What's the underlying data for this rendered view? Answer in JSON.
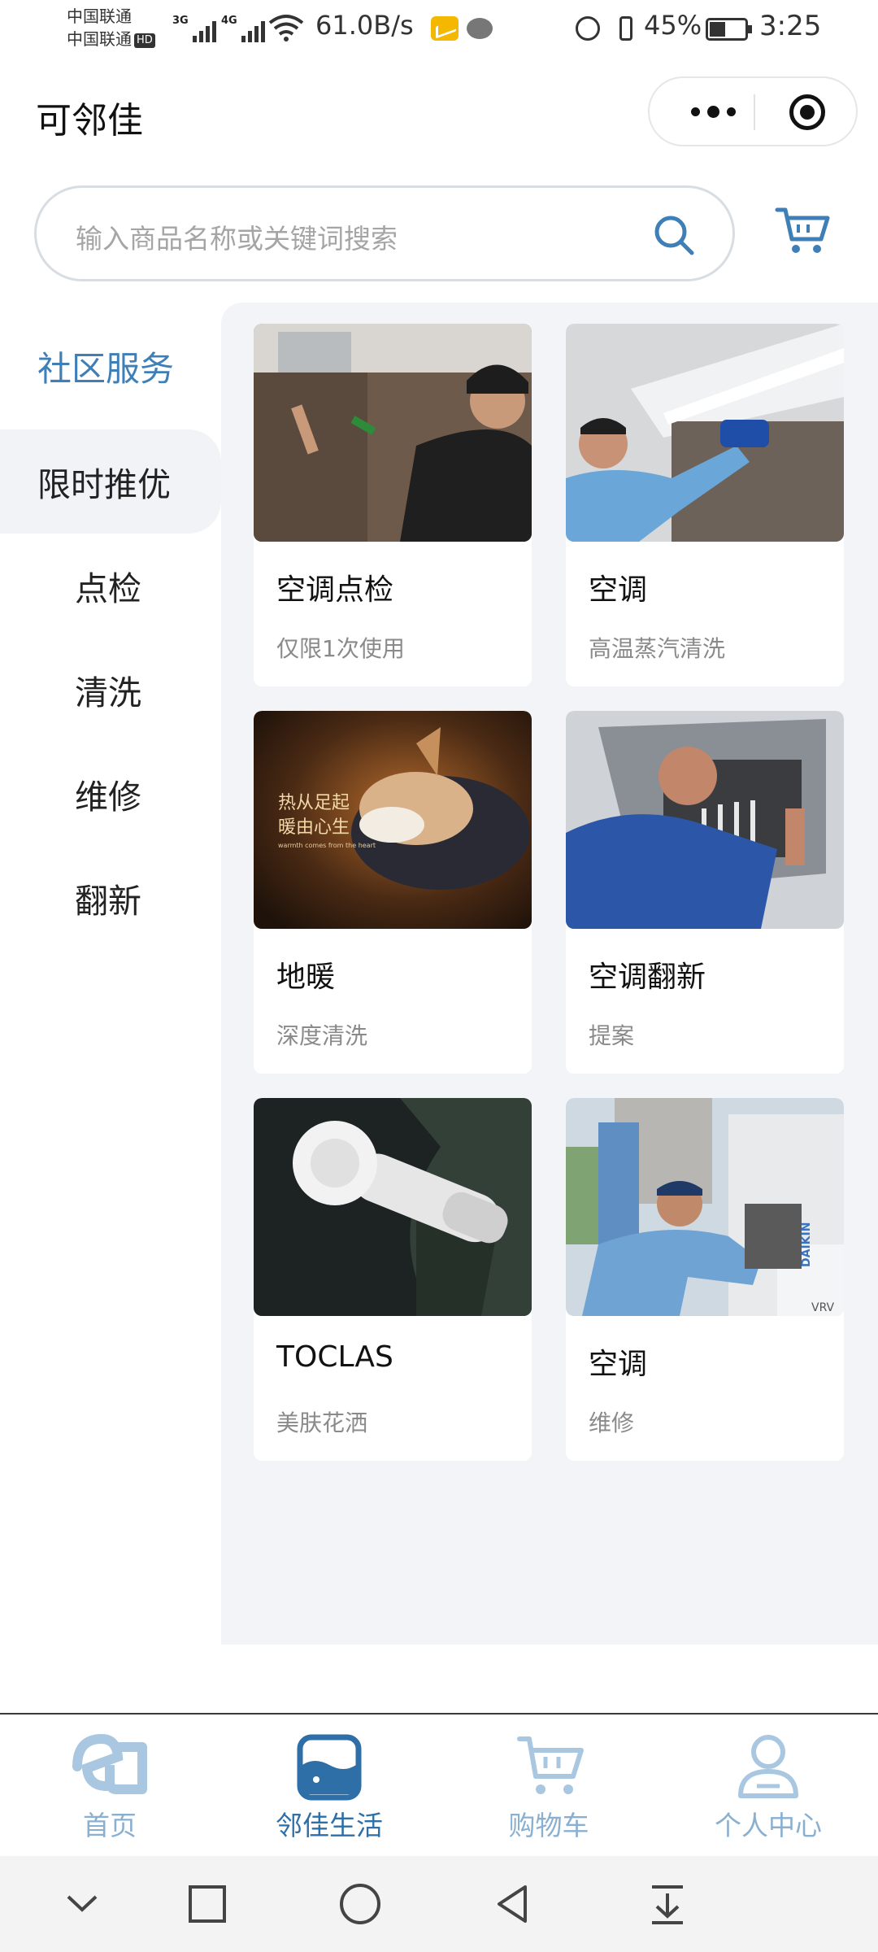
{
  "status_bar": {
    "carrier1": "中国联通",
    "carrier2": "中国联通",
    "hd": "HD",
    "net1": "3G",
    "net2": "4G",
    "speed": "61.0B/s",
    "battery": "45%",
    "battery_level": 0.45,
    "time": "3:25"
  },
  "header": {
    "title": "可邻佳"
  },
  "search": {
    "placeholder": "输入商品名称或关键词搜索"
  },
  "sidebar": {
    "category": "社区服务",
    "items": [
      {
        "label": "限时推优",
        "active": true
      },
      {
        "label": "点检"
      },
      {
        "label": "清洗"
      },
      {
        "label": "维修"
      },
      {
        "label": "翻新"
      }
    ]
  },
  "products": [
    {
      "title": "空调点检",
      "sub": "仅限1次使用",
      "image": "technician-inspecting-ac-photo"
    },
    {
      "title": "空调",
      "sub": "高温蒸汽清洗",
      "image": "technician-cleaning-ac-photo"
    },
    {
      "title": "地暖",
      "sub": "深度清洗",
      "image": "dog-on-warm-floor-photo",
      "image_text": {
        "line1": "热从足起",
        "line2": "暖由心生",
        "line3": "warmth comes from the heart"
      }
    },
    {
      "title": "空调翻新",
      "sub": "提案",
      "image": "technician-in-ceiling-photo"
    },
    {
      "title": "TOCLAS",
      "sub": "美肤花洒",
      "image": "shower-head-photo"
    },
    {
      "title": "空调",
      "sub": "维修",
      "image": "outdoor-unit-repair-photo",
      "image_text": {
        "brand": "DAIKIN",
        "model": "VRV"
      }
    }
  ],
  "tabbar": {
    "tabs": [
      {
        "label": "首页",
        "icon": "home-logo-icon"
      },
      {
        "label": "邻佳生活",
        "icon": "life-icon",
        "active": true
      },
      {
        "label": "购物车",
        "icon": "cart-icon"
      },
      {
        "label": "个人中心",
        "icon": "user-icon"
      }
    ]
  },
  "colors": {
    "accent": "#3f7fb7",
    "tab_active": "#2e6fa8",
    "tab_inactive": "#8ab0d1",
    "panel_bg": "#f2f4f8"
  }
}
